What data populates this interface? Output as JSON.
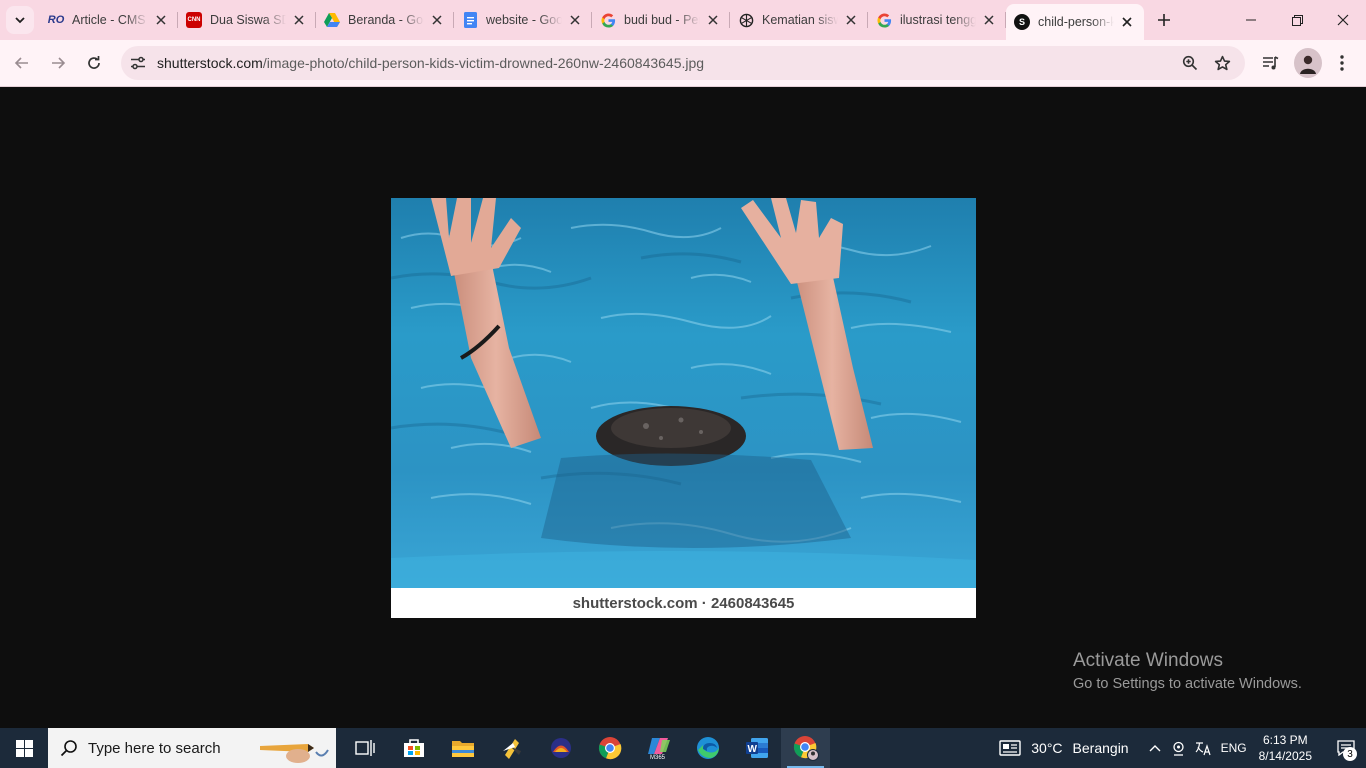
{
  "browser": {
    "tabs": [
      {
        "title": "Article - CMS",
        "favicon": "ro-logo-icon",
        "fav_color": "#2d2d2d",
        "fav_text": "RO"
      },
      {
        "title": "Dua Siswa SD",
        "favicon": "cnn-icon",
        "fav_color": "#cc0000",
        "fav_text": "CNN"
      },
      {
        "title": "Beranda - Google Drive",
        "favicon": "google-drive-icon",
        "fav_color": "",
        "fav_text": ""
      },
      {
        "title": "website - Google Docs",
        "favicon": "google-docs-icon",
        "fav_color": "#4285f4",
        "fav_text": ""
      },
      {
        "title": "budi bud - Penelusuran",
        "favicon": "google-icon",
        "fav_color": "",
        "fav_text": ""
      },
      {
        "title": "Kematian siswa",
        "favicon": "chatgpt-icon",
        "fav_color": "",
        "fav_text": ""
      },
      {
        "title": "ilustrasi tenggelam",
        "favicon": "google-icon",
        "fav_color": "",
        "fav_text": ""
      },
      {
        "title": "child-person-kids",
        "favicon": "shutterstock-icon",
        "fav_color": "#111111",
        "fav_text": "S"
      }
    ],
    "active_tab": 7,
    "url_host": "shutterstock.com",
    "url_path": "/image-photo/child-person-kids-victim-drowned-260nw-2460843645.jpg"
  },
  "content": {
    "watermark": "shutterstock.com · 2460843645",
    "activate_title": "Activate Windows",
    "activate_sub": "Go to Settings to activate Windows."
  },
  "taskbar": {
    "search_placeholder": "Type here to search",
    "apps": [
      "task-view-icon",
      "microsoft-store-icon",
      "file-explorer-icon",
      "app-icon",
      "app-icon",
      "chrome-icon",
      "m365-icon",
      "edge-icon",
      "word-icon",
      "chrome-profile-icon"
    ],
    "temperature": "30°C",
    "weather": "Berangin",
    "lang": "ENG",
    "time": "6:13 PM",
    "date": "8/14/2025",
    "notifications": "3"
  },
  "colors": {
    "tabstrip": "#f9d8e3",
    "toolbar": "#fff3f7",
    "taskbar": "#1c2a3a"
  }
}
